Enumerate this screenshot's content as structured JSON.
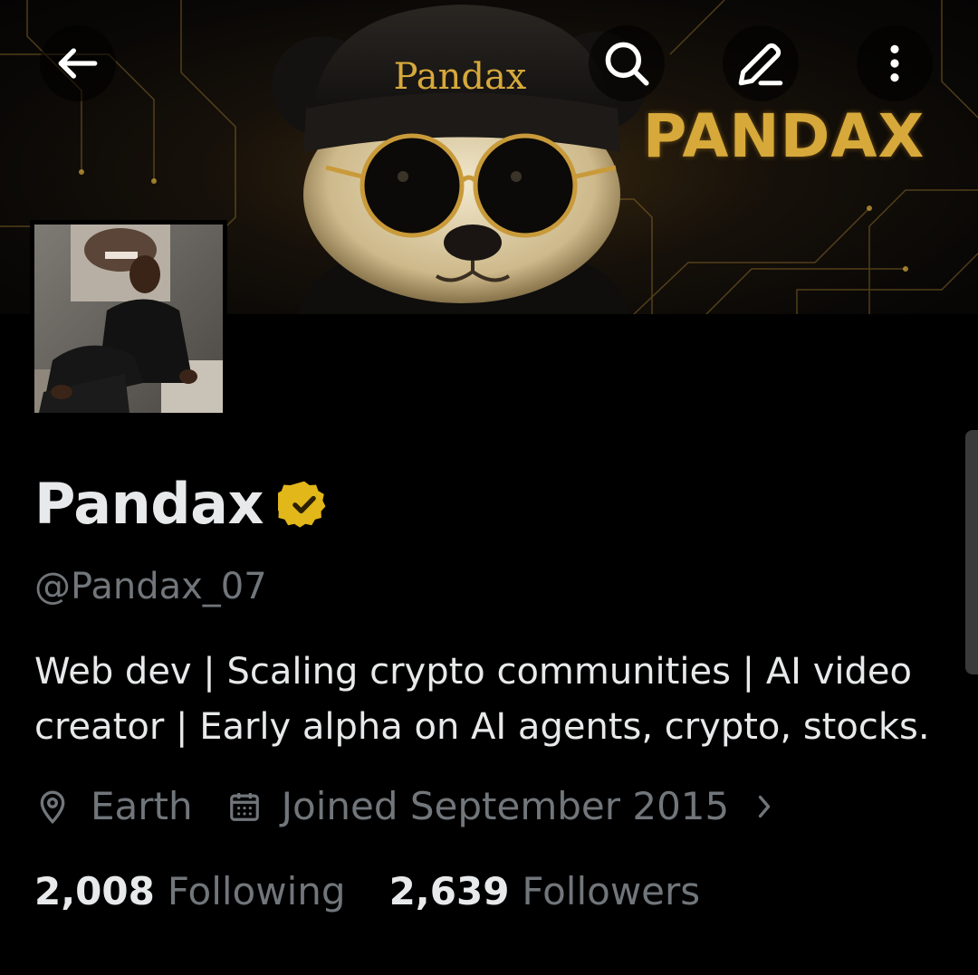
{
  "banner": {
    "brand_text": "PANDAX",
    "hat_text": "Pandax",
    "accent_color": "#d7a93a"
  },
  "toolbar": {
    "back_icon": "arrow-left-icon",
    "search_icon": "search-icon",
    "edit_icon": "pencil-icon",
    "more_icon": "more-vertical-icon"
  },
  "profile": {
    "display_name": "Pandax",
    "verified_badge_color": "#e2b719",
    "handle": "@Pandax_07",
    "bio": "Web dev | Scaling crypto communities | AI video creator | Early alpha on AI agents, crypto, stocks.",
    "location": "Earth",
    "joined": "Joined September 2015"
  },
  "stats": {
    "following_count": "2,008",
    "following_label": "Following",
    "followers_count": "2,639",
    "followers_label": "Followers"
  }
}
